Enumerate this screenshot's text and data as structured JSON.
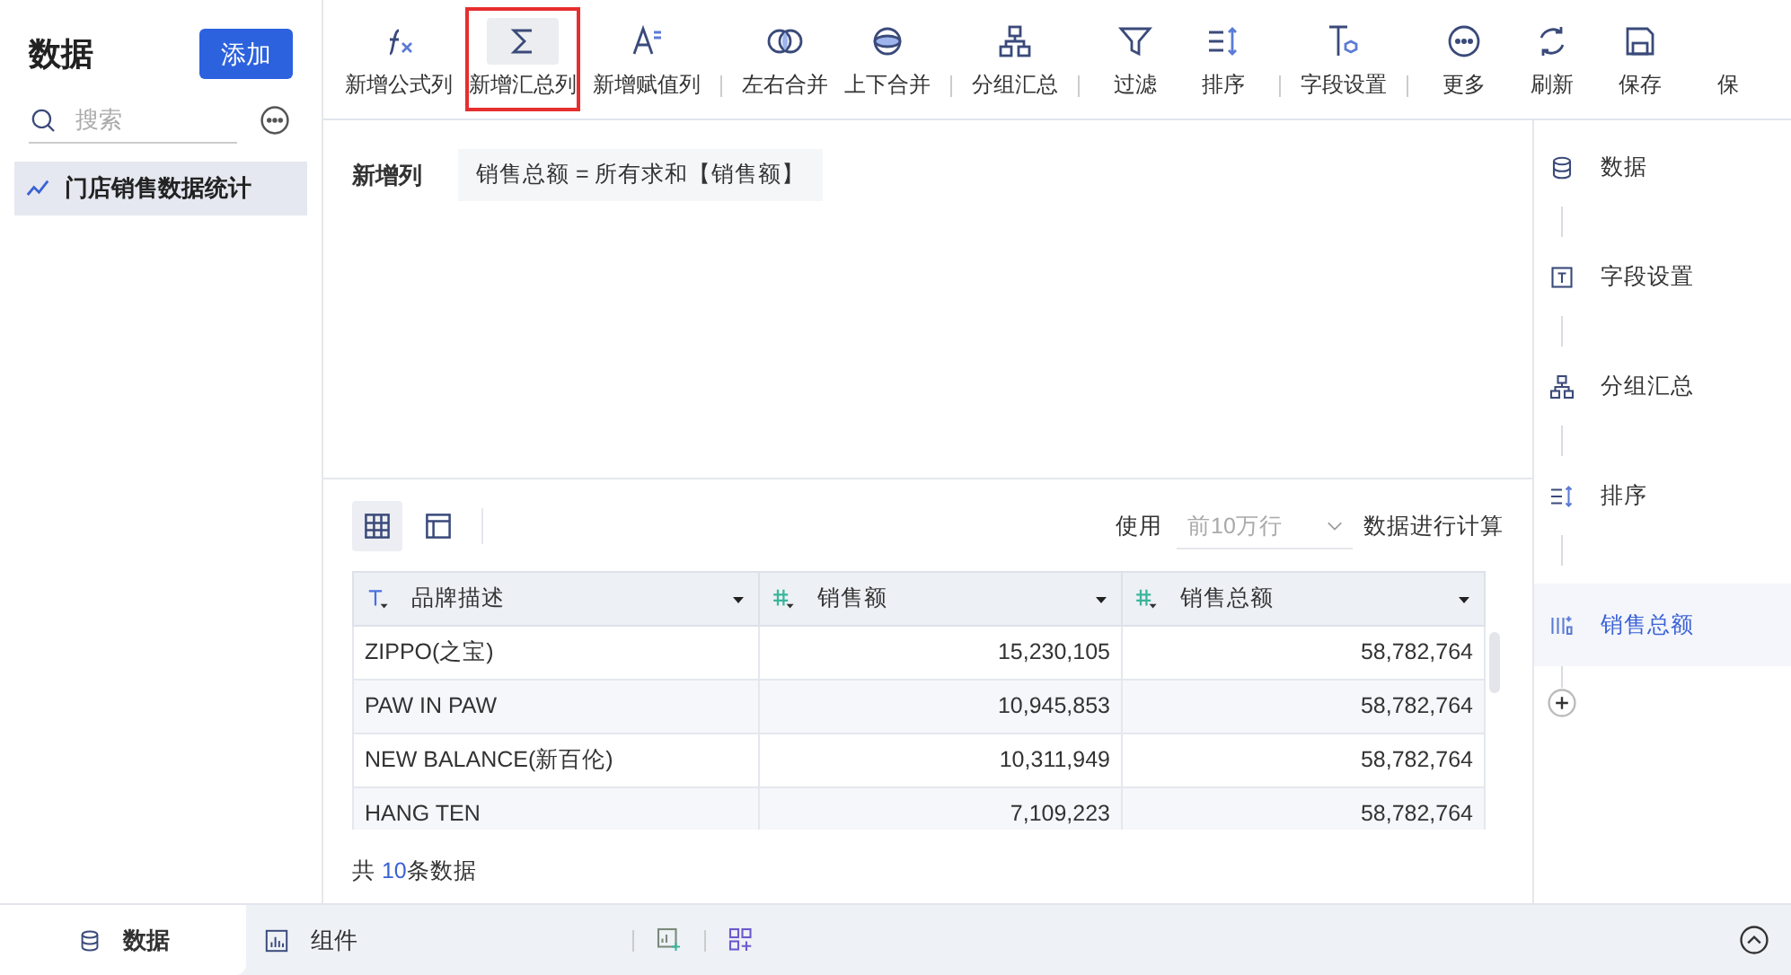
{
  "sidebar": {
    "title": "数据",
    "add_button": "添加",
    "search": {
      "placeholder": "搜索"
    },
    "items": [
      {
        "label": "门店销售数据统计",
        "selected": true
      }
    ]
  },
  "toolbar": [
    {
      "label": "新增公式列",
      "selected": false,
      "divider_after": false
    },
    {
      "label": "新增汇总列",
      "selected": true,
      "divider_after": false
    },
    {
      "label": "新增赋值列",
      "selected": false,
      "divider_after": true
    },
    {
      "label": "左右合并",
      "selected": false,
      "divider_after": false
    },
    {
      "label": "上下合并",
      "selected": false,
      "divider_after": true
    },
    {
      "label": "分组汇总",
      "selected": false,
      "divider_after": true
    },
    {
      "label": "过滤",
      "selected": false,
      "divider_after": false
    },
    {
      "label": "排序",
      "selected": false,
      "divider_after": true
    },
    {
      "label": "字段设置",
      "selected": false,
      "divider_after": true
    },
    {
      "label": "更多",
      "selected": false,
      "divider_after": false
    },
    {
      "label": "刷新",
      "selected": false,
      "divider_after": false
    },
    {
      "label": "保存",
      "selected": false,
      "divider_after": false
    },
    {
      "label": "保",
      "selected": false,
      "divider_after": false
    }
  ],
  "formula": {
    "label": "新增列",
    "expression": "销售总额 = 所有求和【销售额】"
  },
  "preview": {
    "view_modes": [
      {
        "selected": true
      },
      {
        "selected": false
      }
    ],
    "use_label": "使用",
    "row_limit": {
      "placeholder": "前10万行"
    },
    "calc_label": "数据进行计算"
  },
  "table": {
    "columns": [
      {
        "name": "品牌描述",
        "kind": "text"
      },
      {
        "name": "销售额",
        "kind": "number"
      },
      {
        "name": "销售总额",
        "kind": "number"
      }
    ],
    "rows": [
      [
        "ZIPPO(之宝)",
        "15,230,105",
        "58,782,764"
      ],
      [
        "PAW IN PAW",
        "10,945,853",
        "58,782,764"
      ],
      [
        "NEW BALANCE(新百伦)",
        "10,311,949",
        "58,782,764"
      ],
      [
        "HANG TEN",
        "7,109,223",
        "58,782,764"
      ]
    ],
    "footer": {
      "prefix": "共",
      "count": "10",
      "suffix": "条数据"
    }
  },
  "steps": [
    {
      "label": "数据",
      "selected": false
    },
    {
      "label": "字段设置",
      "selected": false
    },
    {
      "label": "分组汇总",
      "selected": false
    },
    {
      "label": "排序",
      "selected": false
    },
    {
      "label": "销售总额",
      "selected": true
    }
  ],
  "bottom_tabs": [
    {
      "label": "数据",
      "selected": true
    },
    {
      "label": "组件",
      "selected": false
    }
  ]
}
